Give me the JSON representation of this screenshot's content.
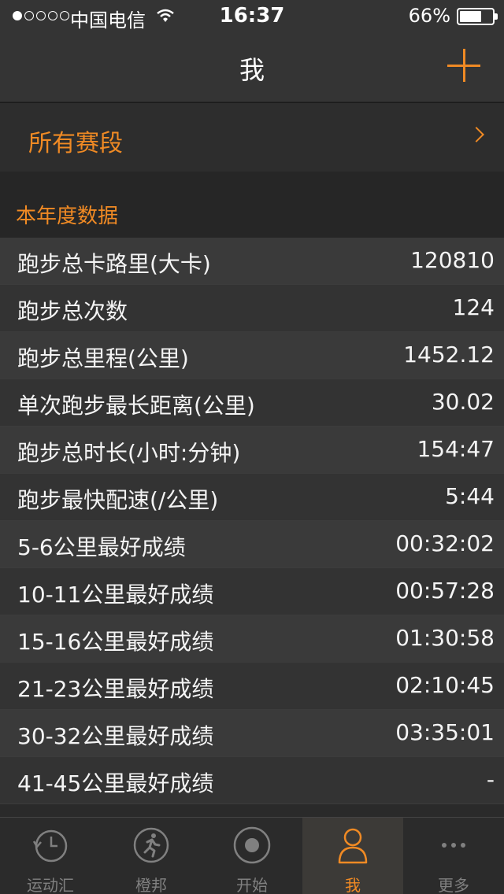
{
  "status_bar": {
    "carrier": "中国电信",
    "time": "16:37",
    "battery_percent": "66%",
    "battery_level": 0.66,
    "signal_bars_filled": 1,
    "signal_bars_total": 5
  },
  "nav": {
    "title": "我",
    "add_icon": "plus-icon"
  },
  "all_races": {
    "label": "所有赛段",
    "icon": "chevron-right-icon"
  },
  "section": {
    "title": "本年度数据"
  },
  "stats": [
    {
      "label": "跑步总卡路里(大卡)",
      "value": "120810"
    },
    {
      "label": "跑步总次数",
      "value": "124"
    },
    {
      "label": "跑步总里程(公里)",
      "value": "1452.12"
    },
    {
      "label": "单次跑步最长距离(公里)",
      "value": "30.02"
    },
    {
      "label": "跑步总时长(小时:分钟)",
      "value": "154:47"
    },
    {
      "label": "跑步最快配速(/公里)",
      "value": "5:44"
    },
    {
      "label": "5-6公里最好成绩",
      "value": "00:32:02"
    },
    {
      "label": "10-11公里最好成绩",
      "value": "00:57:28"
    },
    {
      "label": "15-16公里最好成绩",
      "value": "01:30:58"
    },
    {
      "label": "21-23公里最好成绩",
      "value": "02:10:45"
    },
    {
      "label": "30-32公里最好成绩",
      "value": "03:35:01"
    },
    {
      "label": "41-45公里最好成绩",
      "value": "-"
    }
  ],
  "tabs": [
    {
      "label": "运动汇",
      "icon": "history-clock-icon",
      "active": false
    },
    {
      "label": "橙邦",
      "icon": "runner-icon",
      "active": false
    },
    {
      "label": "开始",
      "icon": "start-record-icon",
      "active": false
    },
    {
      "label": "我",
      "icon": "person-icon",
      "active": true
    },
    {
      "label": "更多",
      "icon": "more-dots-icon",
      "active": false
    }
  ],
  "colors": {
    "accent": "#f08a24",
    "background": "#1a1a1a",
    "row_odd": "#3a3a3a",
    "row_even": "#333333"
  }
}
